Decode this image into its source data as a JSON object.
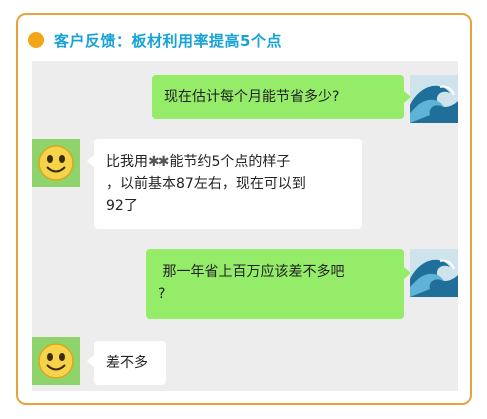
{
  "header": {
    "title": "客户反馈：板材利用率提高5个点"
  },
  "messages": [
    {
      "side": "right",
      "text": "现在估计每个月能节省多少?"
    },
    {
      "side": "left",
      "text_prefix": "比我用",
      "masked": "✱✱",
      "text_line1_rest": "能节约5个点的样子",
      "text_line2": "，以前基本87左右，现在可以到",
      "text_line3": "92了"
    },
    {
      "side": "right",
      "text_line1": " 那一年省上百万应该差不多吧",
      "text_line2": "?"
    },
    {
      "side": "left",
      "text": "差不多"
    }
  ],
  "colors": {
    "accent": "#E8A33C",
    "title": "#17A2D6",
    "sent_bubble": "#95EC69",
    "received_bubble": "#FFFFFF",
    "chat_bg": "#EDEDED"
  },
  "icons": {
    "header_dot": "orange-dot-icon",
    "user_avatar": "ocean-wave-avatar",
    "customer_avatar": "smiley-face-avatar"
  }
}
